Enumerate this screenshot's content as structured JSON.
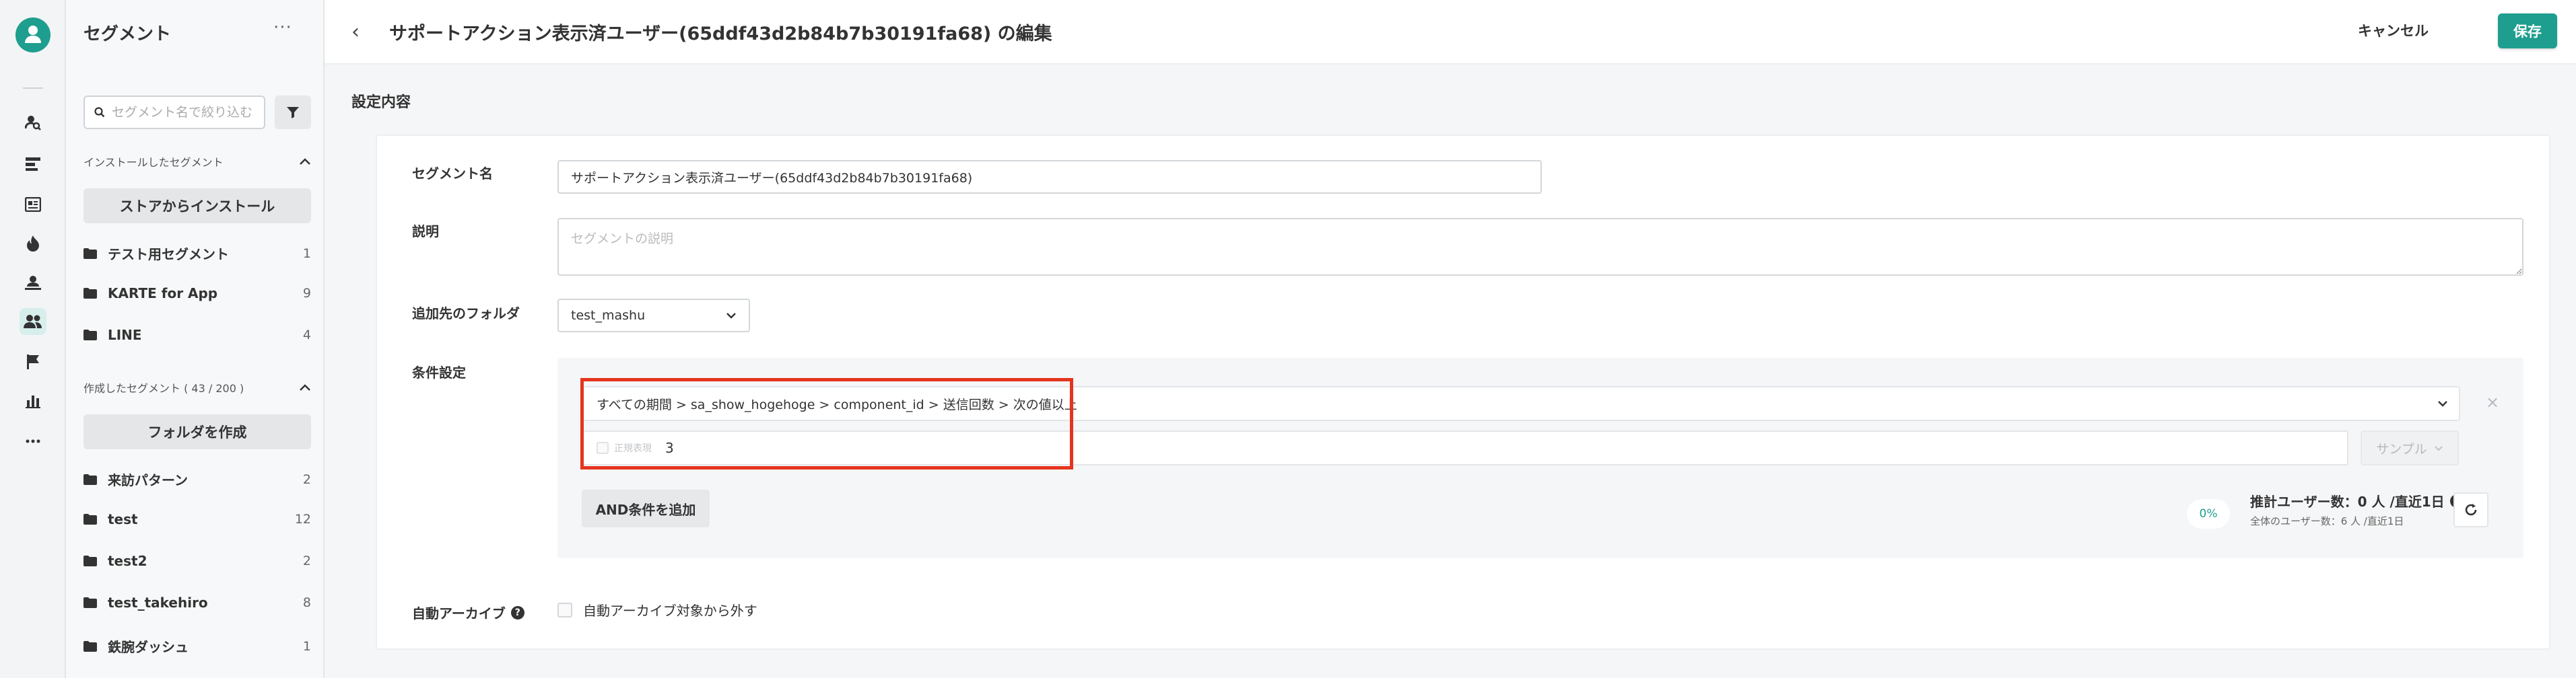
{
  "sidebar": {
    "title": "セグメント",
    "more": "···",
    "search_placeholder": "セグメント名で絞り込む",
    "installed_section": "インストールしたセグメント",
    "install_button": "ストアからインストール",
    "installed": [
      {
        "name": "テスト用セグメント",
        "count": "1"
      },
      {
        "name": "KARTE for App",
        "count": "9"
      },
      {
        "name": "LINE",
        "count": "4"
      }
    ],
    "created_section": "作成したセグメント ( 43 / 200 )",
    "create_folder_button": "フォルダを作成",
    "created": [
      {
        "name": "来訪パターン",
        "count": "2"
      },
      {
        "name": "test",
        "count": "12"
      },
      {
        "name": "test2",
        "count": "2"
      },
      {
        "name": "test_takehiro",
        "count": "8"
      },
      {
        "name": "鉄腕ダッシュ",
        "count": "1"
      }
    ]
  },
  "header": {
    "back": "‹",
    "title": "サポートアクション表示済ユーザー(65ddf43d2b84b7b30191fa68) の編集",
    "cancel": "キャンセル",
    "save": "保存"
  },
  "section_title": "設定内容",
  "form": {
    "name_label": "セグメント名",
    "name_value": "サポートアクション表示済ユーザー(65ddf43d2b84b7b30191fa68)",
    "desc_label": "説明",
    "desc_placeholder": "セグメントの説明",
    "folder_label": "追加先のフォルダ",
    "folder_value": "test_mashu",
    "condition_label": "条件設定",
    "condition_path": "すべての期間 > sa_show_hogehoge > component_id > 送信回数 > 次の値以上",
    "remove": "×",
    "regex_label": "正規表現",
    "condition_value": "3",
    "sample_button": "サンプル",
    "and_button": "AND条件を追加",
    "percent": "0%",
    "estimate": "推計ユーザー数：0 人 /直近1日",
    "total": "全体のユーザー数：6 人 /直近1日",
    "archive_label": "自動アーカイブ",
    "archive_option": "自動アーカイブ対象から外す"
  },
  "colors": {
    "accent": "#1e9e8e",
    "highlight": "#e5341e"
  }
}
